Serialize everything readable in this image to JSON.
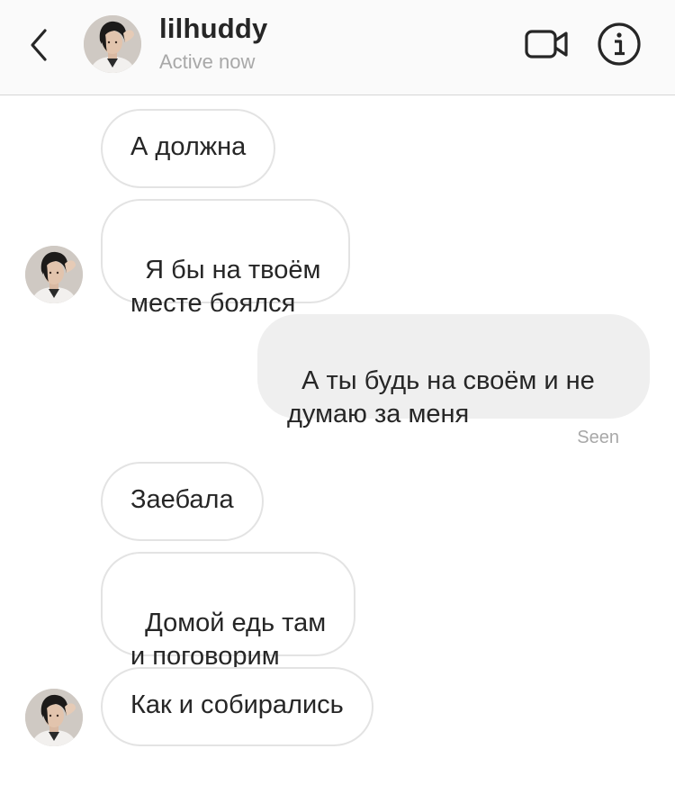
{
  "header": {
    "username": "lilhuddy",
    "status": "Active now"
  },
  "messages": [
    {
      "direction": "in",
      "text": "А должна"
    },
    {
      "direction": "in",
      "text": "Я бы на твоём\nместе боялся"
    },
    {
      "direction": "out",
      "text": "А ты будь на своём и не\nдумаю за меня"
    },
    {
      "direction": "in",
      "text": "Заебала"
    },
    {
      "direction": "in",
      "text": "Домой едь там\nи поговорим"
    },
    {
      "direction": "in",
      "text": "Как и собирались"
    }
  ],
  "seen_label": "Seen",
  "icons": {
    "back": "chevron-left-icon",
    "video": "video-camera-icon",
    "info": "info-icon"
  },
  "colors": {
    "header_bg": "#fafafa",
    "outgoing_bubble": "#efefef",
    "incoming_border": "#e3e3e3",
    "secondary_text": "#a8a8a8"
  }
}
